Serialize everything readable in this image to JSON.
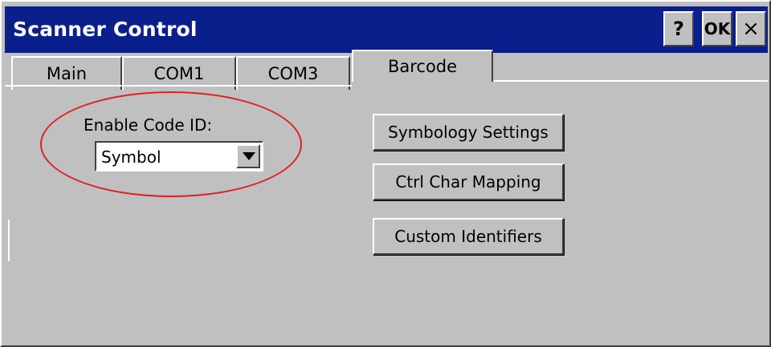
{
  "window": {
    "title": "Scanner Control",
    "help_label": "?",
    "ok_label": "OK",
    "close_label": "×"
  },
  "tabs": [
    {
      "label": "Main",
      "selected": false
    },
    {
      "label": "COM1",
      "selected": false
    },
    {
      "label": "COM3",
      "selected": false
    },
    {
      "label": "Barcode",
      "selected": true
    }
  ],
  "barcode_tab": {
    "enable_code_id_label": "Enable Code ID:",
    "enable_code_id_value": "Symbol",
    "buttons": {
      "symbology_settings": "Symbology Settings",
      "ctrl_char_mapping": "Ctrl Char Mapping",
      "custom_identifiers": "Custom Identifiers"
    }
  },
  "colors": {
    "titlebar": "#0a1f8c",
    "highlight": "#e02020",
    "face": "#c0c0c0"
  }
}
